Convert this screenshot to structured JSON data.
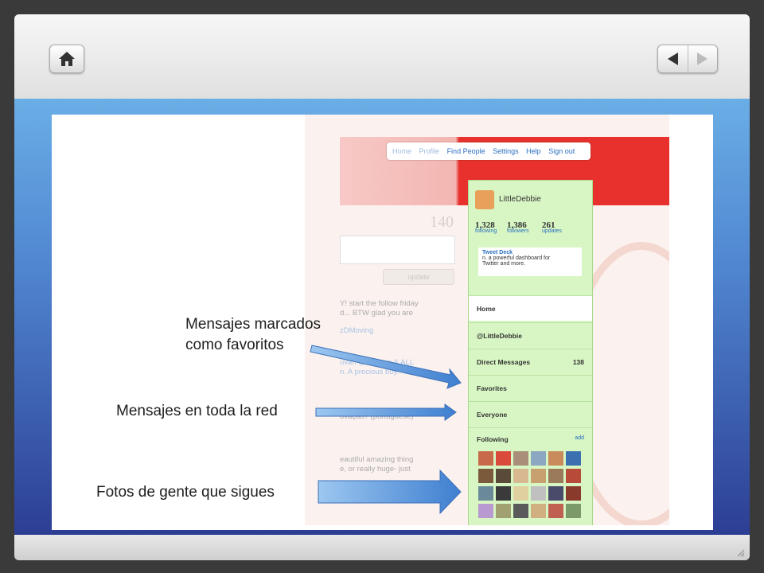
{
  "nav": {
    "home_icon": "home-icon",
    "prev_icon": "triangle-left-icon",
    "next_icon": "triangle-right-icon"
  },
  "screenshot": {
    "topnav": [
      "Home",
      "Profile",
      "Find People",
      "Settings",
      "Help",
      "Sign out"
    ],
    "counter": "140",
    "update_button": "update",
    "faded_lines": [
      "Y! start the follow friday",
      "d... BTW glad you are",
      "zDMoving",
      "uvan @twineim & ALL",
      "n. A precious boy.",
      "ovação? (portuguese)",
      "eautiful amazing thing",
      "e, or really huge- just"
    ],
    "profile": {
      "name": "LittleDebbie",
      "stats": [
        {
          "num": "1,328",
          "label": "following"
        },
        {
          "num": "1,386",
          "label": "followers"
        },
        {
          "num": "261",
          "label": "updates"
        }
      ],
      "tweetdeck": {
        "title": "Tweet Deck",
        "line1": "n. a powerful dashboard for",
        "line2": "Twitter and more."
      }
    },
    "menu": [
      {
        "label": "Home",
        "count": ""
      },
      {
        "label": "@LittleDebbie",
        "count": ""
      },
      {
        "label": "Direct Messages",
        "count": "138"
      },
      {
        "label": "Favorites",
        "count": ""
      },
      {
        "label": "Everyone",
        "count": ""
      }
    ],
    "following": {
      "label": "Following",
      "add": "add"
    }
  },
  "callouts": {
    "favorites_line1": "Mensajes marcados",
    "favorites_line2": "como favoritos",
    "everyone": "Mensajes en toda la red",
    "following": "Fotos de gente que sigues"
  },
  "colors": {
    "slide_bg_top": "#6aaee6",
    "slide_bg_bottom": "#2c3e94",
    "twitter_red": "#e8312d",
    "sidebar_green": "#d8f6c4",
    "link_blue": "#2a6ebf",
    "arrow_blue": "#4f8fd8"
  }
}
